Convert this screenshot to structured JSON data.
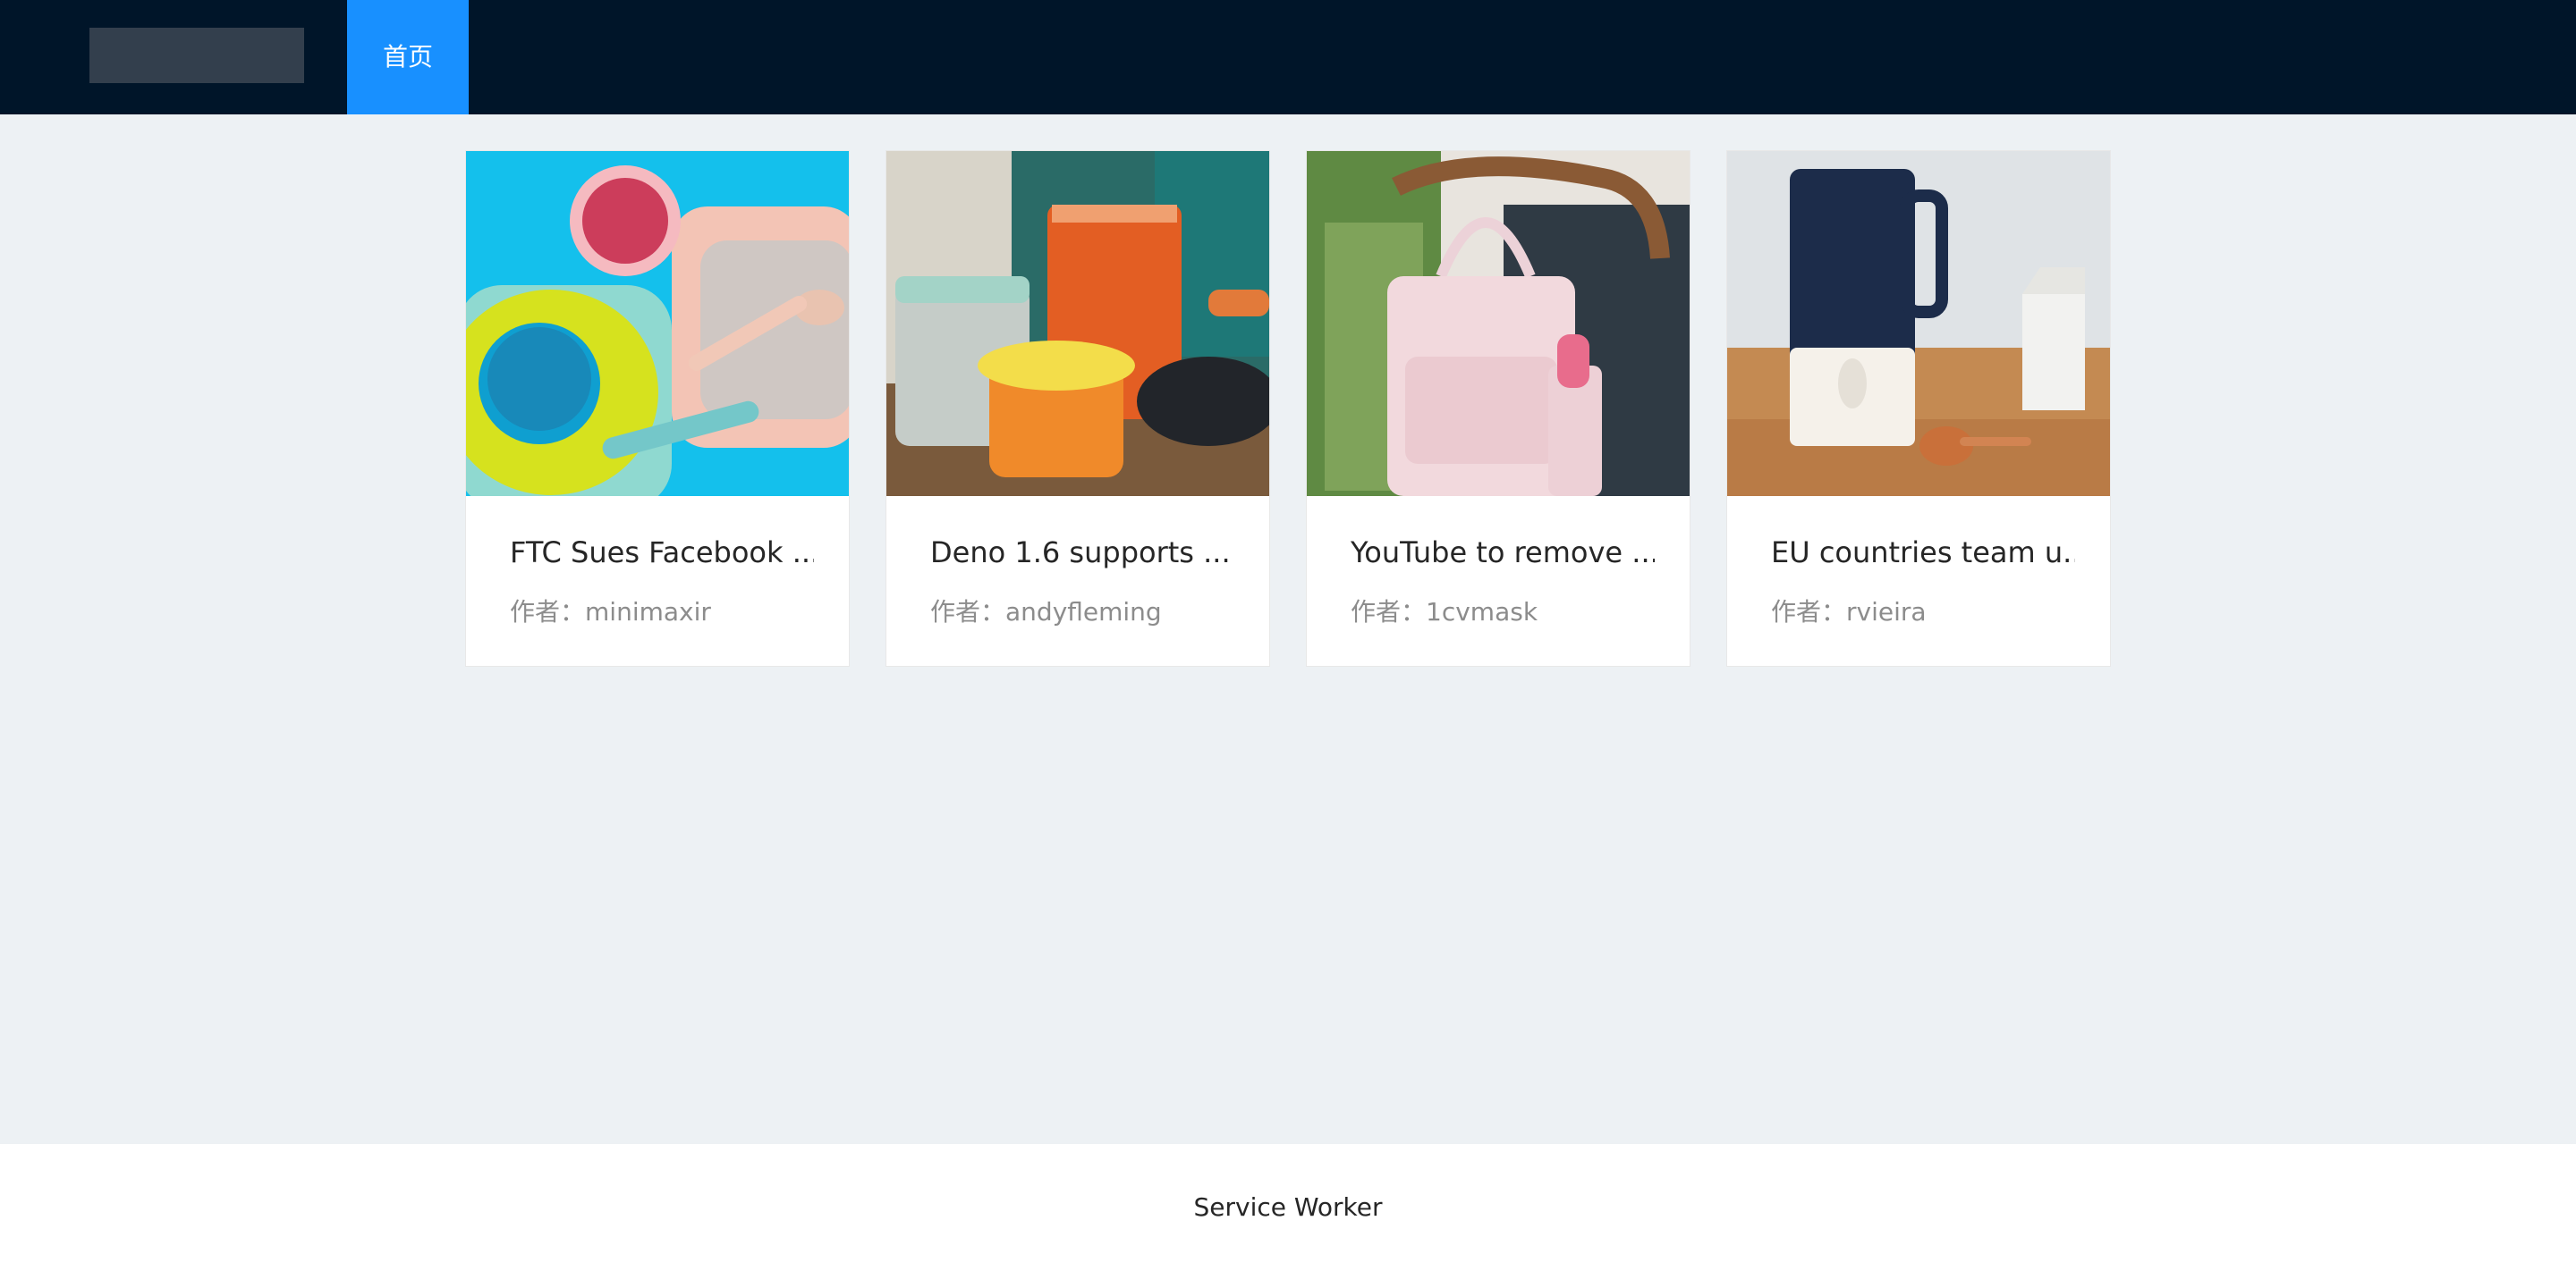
{
  "header": {
    "nav": [
      {
        "label": "首页"
      }
    ]
  },
  "cards": [
    {
      "title": "FTC Sues Facebook ...",
      "author_prefix": "作者：",
      "author": "minimaxir",
      "image": "tableware-photo"
    },
    {
      "title": "Deno 1.6 supports ...",
      "author_prefix": "作者：",
      "author": "andyfleming",
      "image": "food-jars-photo"
    },
    {
      "title": "YouTube to remove ...",
      "author_prefix": "作者：",
      "author": "1cvmask",
      "image": "diaper-bag-photo"
    },
    {
      "title": "EU countries team u...",
      "author_prefix": "作者：",
      "author": "rvieira",
      "image": "milk-maker-photo"
    }
  ],
  "footer": {
    "label": "Service Worker"
  },
  "colors": {
    "header_bg": "#001529",
    "nav_active": "#1890ff",
    "page_bg": "#edf1f4"
  }
}
